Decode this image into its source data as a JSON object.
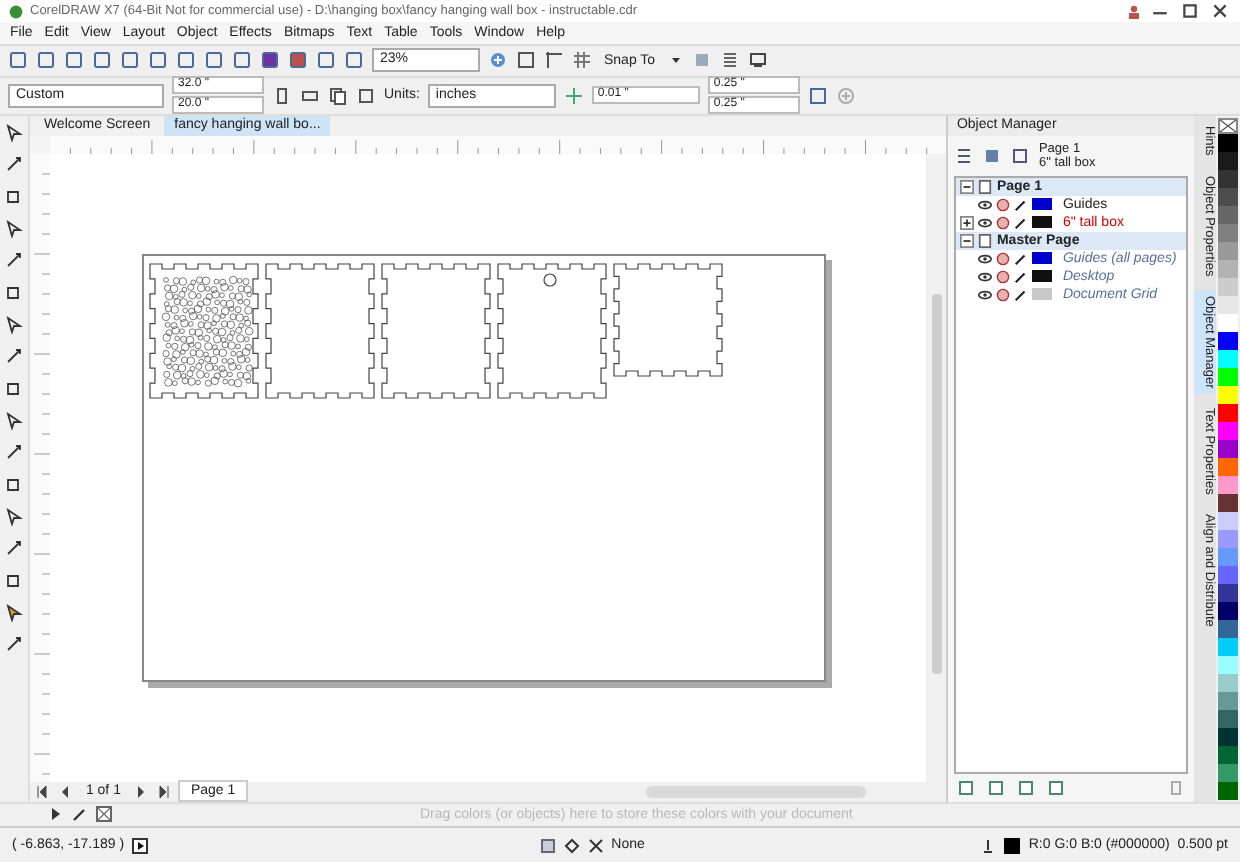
{
  "window": {
    "title": "CorelDRAW X7 (64-Bit Not for commercial use) - D:\\hanging box\\fancy hanging wall box - instructable.cdr"
  },
  "menu": [
    "File",
    "Edit",
    "View",
    "Layout",
    "Object",
    "Effects",
    "Bitmaps",
    "Text",
    "Table",
    "Tools",
    "Window",
    "Help"
  ],
  "toolbar": {
    "zoom": "23%",
    "snap": "Snap To"
  },
  "property_bar": {
    "page_size": "Custom",
    "width": "32.0 \"",
    "height": "20.0 \"",
    "units_label": "Units:",
    "units": "inches",
    "nudge": "0.01 \"",
    "duplicate_x": "0.25 \"",
    "duplicate_y": "0.25 \""
  },
  "document_tabs": [
    {
      "label": "Welcome Screen",
      "selected": false
    },
    {
      "label": "fancy hanging wall bo...",
      "selected": true
    }
  ],
  "page_nav": {
    "count": "1 of 1",
    "page_tab": "Page 1"
  },
  "palette_hint": "Drag colors (or objects) here to store these colors with your document",
  "status_bar": {
    "coordinates": "( -6.863, -17.189 )",
    "fill": "None",
    "outline": "R:0 G:0 B:0 (#000000)  0.500 pt"
  },
  "object_manager": {
    "title": "Object Manager",
    "current_page": "Page 1",
    "current_layer": "6\" tall box",
    "pages": [
      {
        "name": "Page 1",
        "expanded": true,
        "master": false,
        "layers": [
          {
            "name": "Guides",
            "color": "#0000cc",
            "active": false,
            "expandable": false
          },
          {
            "name": "6\" tall box",
            "color": "#111111",
            "active": true,
            "expandable": true
          }
        ]
      },
      {
        "name": "Master Page",
        "expanded": true,
        "master": true,
        "layers": [
          {
            "name": "Guides (all pages)",
            "color": "#0000cc",
            "active": false,
            "expandable": false
          },
          {
            "name": "Desktop",
            "color": "#111111",
            "active": false,
            "expandable": false
          },
          {
            "name": "Document Grid",
            "color": "#c8c8c8",
            "active": false,
            "expandable": false
          }
        ]
      }
    ]
  },
  "docker_tabs": [
    {
      "label": "Hints",
      "selected": false
    },
    {
      "label": "Object Properties",
      "selected": false
    },
    {
      "label": "Object Manager",
      "selected": true
    },
    {
      "label": "Text Properties",
      "selected": false
    },
    {
      "label": "Align and Distribute",
      "selected": false
    }
  ],
  "palette": [
    {
      "color": "#000000"
    },
    {
      "color": "#1a1a1a"
    },
    {
      "color": "#333333"
    },
    {
      "color": "#4d4d4d"
    },
    {
      "color": "#666666"
    },
    {
      "color": "#808080"
    },
    {
      "color": "#999999"
    },
    {
      "color": "#b3b3b3"
    },
    {
      "color": "#cccccc"
    },
    {
      "color": "#e6e6e6"
    },
    {
      "color": "#ffffff"
    },
    {
      "color": "#0000ff"
    },
    {
      "color": "#00ffff"
    },
    {
      "color": "#00ff00"
    },
    {
      "color": "#ffff00"
    },
    {
      "color": "#ff0000"
    },
    {
      "color": "#ff00ff"
    },
    {
      "color": "#9900cc"
    },
    {
      "color": "#ff6600"
    },
    {
      "color": "#ff99cc"
    },
    {
      "color": "#663333"
    },
    {
      "color": "#ccccff"
    },
    {
      "color": "#9999ff"
    },
    {
      "color": "#6699ff"
    },
    {
      "color": "#6666ff"
    },
    {
      "color": "#333399"
    },
    {
      "color": "#000066"
    },
    {
      "color": "#336699"
    },
    {
      "color": "#00ccff"
    },
    {
      "color": "#99ffff"
    },
    {
      "color": "#99cccc"
    },
    {
      "color": "#669999"
    },
    {
      "color": "#336666"
    },
    {
      "color": "#003333"
    },
    {
      "color": "#006633"
    },
    {
      "color": "#339966"
    },
    {
      "color": "#006600"
    }
  ]
}
